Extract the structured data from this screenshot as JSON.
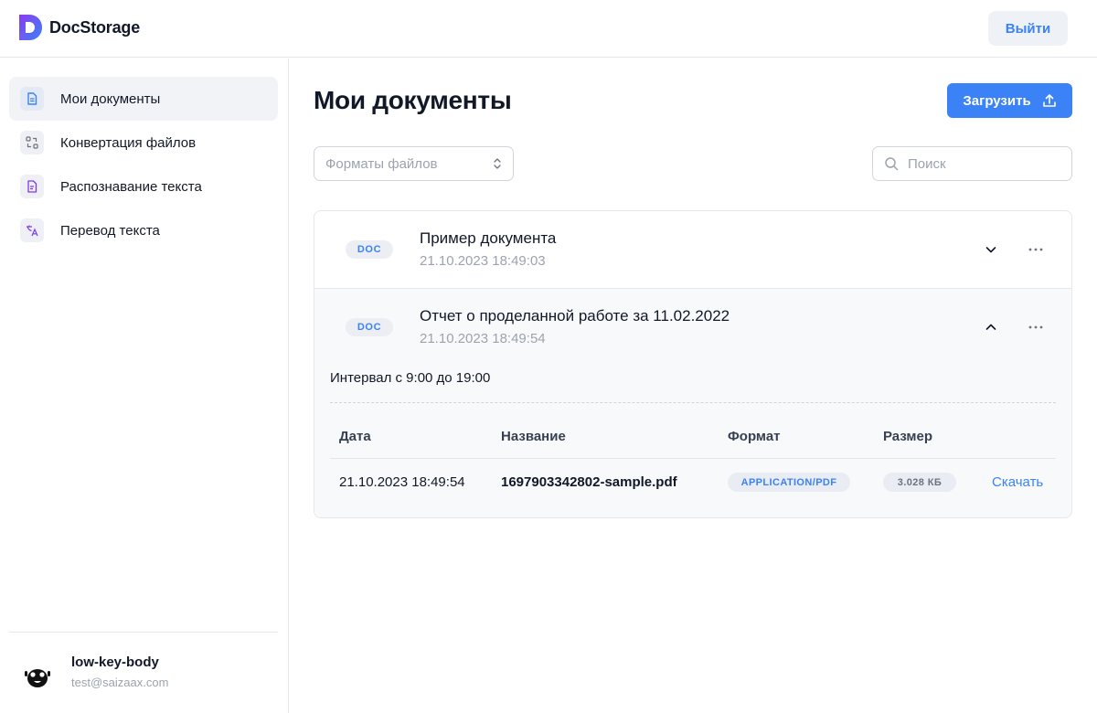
{
  "header": {
    "app_name": "DocStorage",
    "logout_label": "Выйти"
  },
  "sidebar": {
    "items": [
      {
        "label": "Мои документы",
        "icon": "document-icon",
        "active": true
      },
      {
        "label": "Конвертация файлов",
        "icon": "convert-icon",
        "active": false
      },
      {
        "label": "Распознавание текста",
        "icon": "text-recognition-icon",
        "active": false
      },
      {
        "label": "Перевод текста",
        "icon": "translate-icon",
        "active": false
      }
    ],
    "user": {
      "name": "low-key-body",
      "email": "test@saizaax.com"
    }
  },
  "main": {
    "title": "Мои документы",
    "upload_label": "Загрузить",
    "format_filter": {
      "placeholder": "Форматы файлов"
    },
    "search": {
      "placeholder": "Поиск"
    },
    "documents": [
      {
        "badge": "DOC",
        "title": "Пример документа",
        "date": "21.10.2023 18:49:03",
        "expanded": false
      },
      {
        "badge": "DOC",
        "title": "Отчет о проделанной работе за 11.02.2022",
        "date": "21.10.2023 18:49:54",
        "expanded": true,
        "details": {
          "description": "Интервал с 9:00 до 19:00",
          "columns": [
            "Дата",
            "Название",
            "Формат",
            "Размер"
          ],
          "files": [
            {
              "date": "21.10.2023 18:49:54",
              "name": "1697903342802-sample.pdf",
              "format": "APPLICATION/PDF",
              "size": "3.028 КБ",
              "action": "Скачать"
            }
          ]
        }
      }
    ]
  },
  "colors": {
    "accent": "#3b82f6",
    "logo_gradient_start": "#7c3aed",
    "logo_gradient_end": "#3b82f6"
  }
}
